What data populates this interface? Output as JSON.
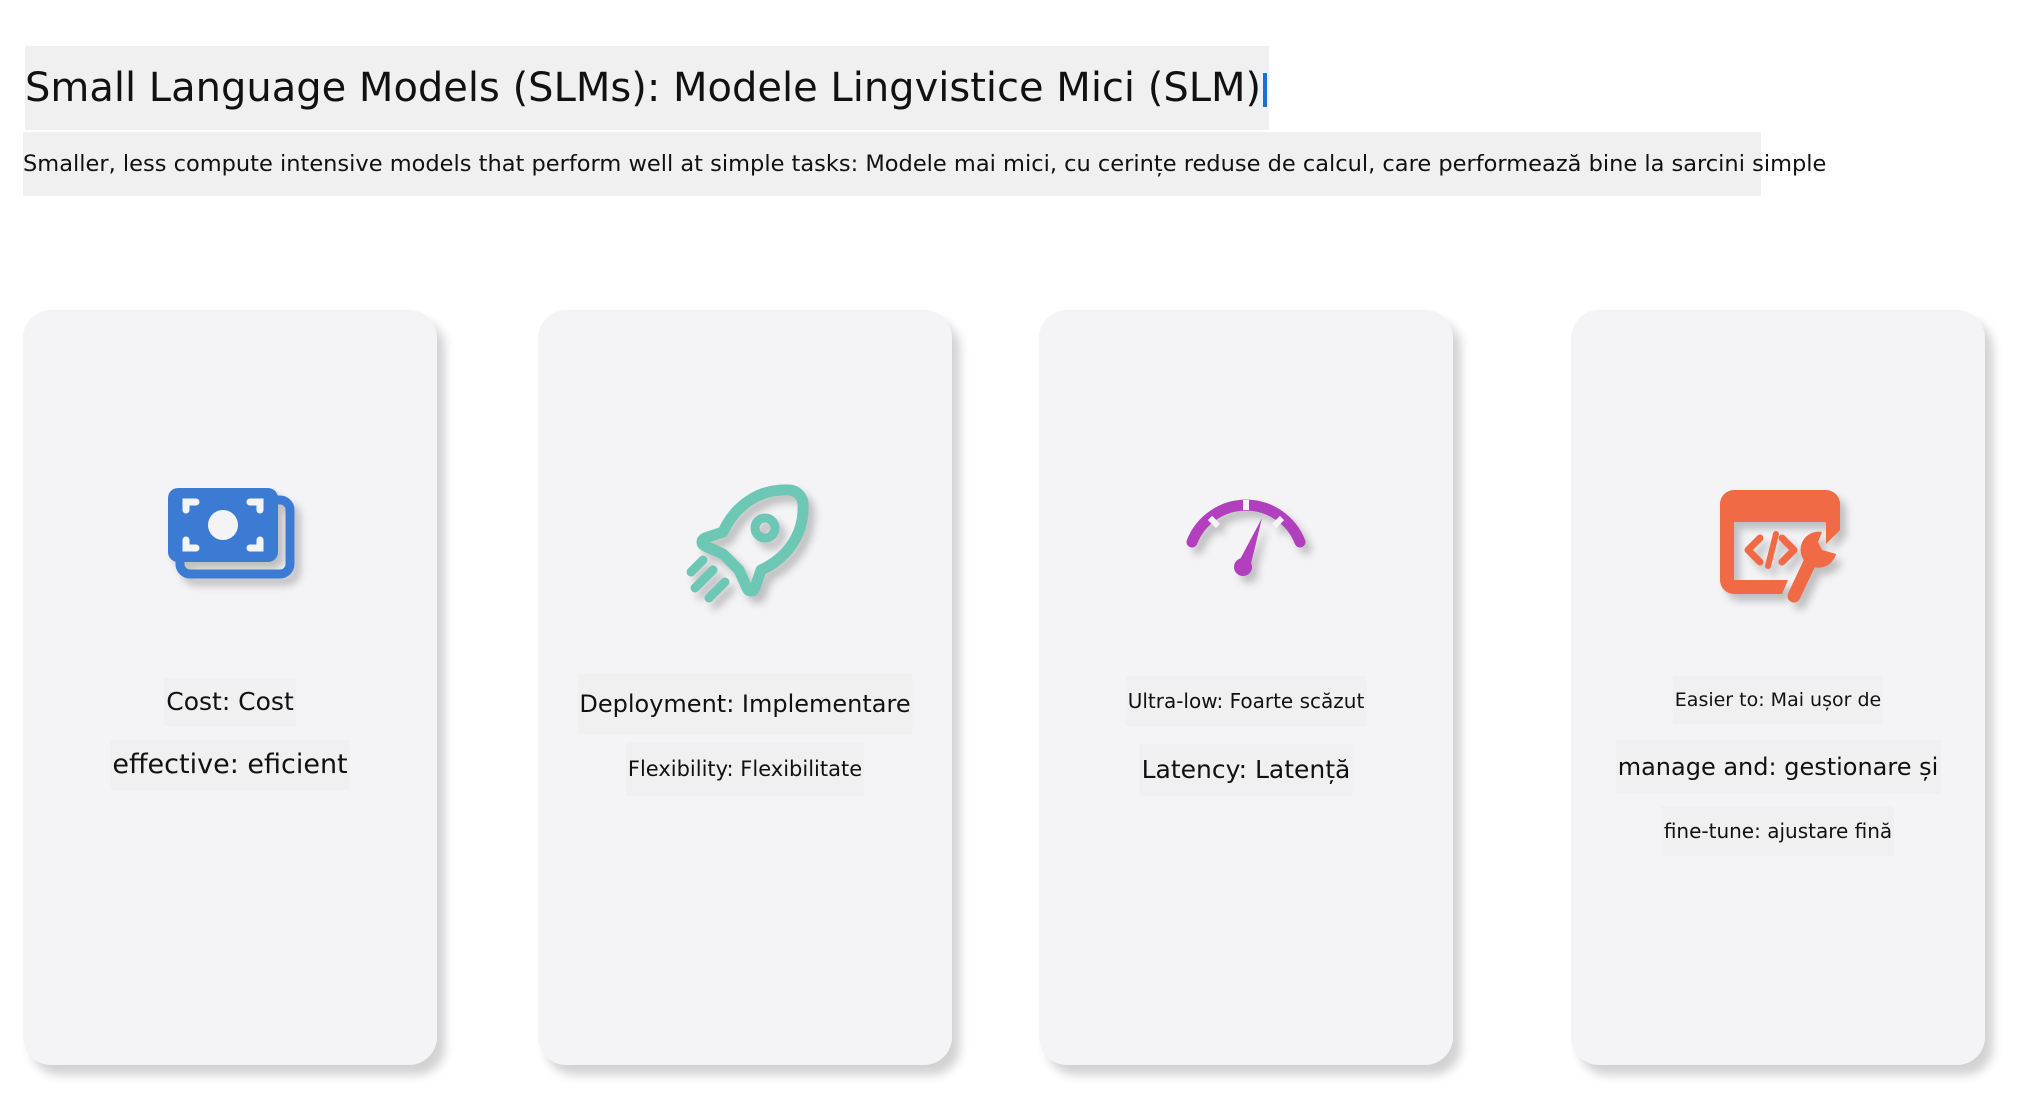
{
  "header": {
    "title": "Small Language Models (SLMs): Modele Lingvistice Mici (SLM)",
    "subtitle": "Smaller, less compute intensive models that perform well at simple tasks: Modele mai mici, cu cerințe reduse de calcul, care performează bine la sarcini simple"
  },
  "cards": [
    {
      "icon": "money-icon",
      "color": "#3b7bd4",
      "lines": [
        "Cost: Cost",
        "effective: eficient"
      ]
    },
    {
      "icon": "rocket-icon",
      "color": "#6cc7b5",
      "lines": [
        "Deployment: Implementare",
        "Flexibility: Flexibilitate"
      ]
    },
    {
      "icon": "speedometer-icon",
      "color": "#b23fbe",
      "lines": [
        "Ultra-low: Foarte scăzut",
        "Latency: Latență"
      ]
    },
    {
      "icon": "code-wrench-icon",
      "color": "#ef6a45",
      "lines": [
        "Easier to: Mai ușor de",
        "manage and: gestionare și",
        "fine-tune: ajustare fină"
      ]
    }
  ]
}
